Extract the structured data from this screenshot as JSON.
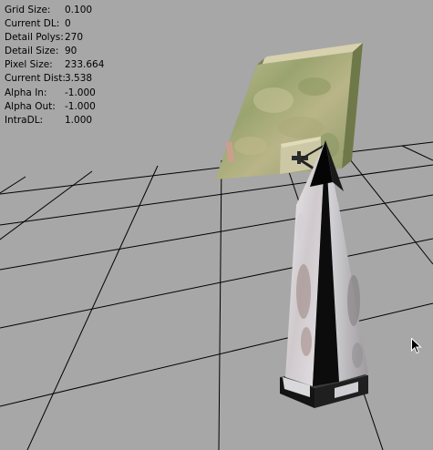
{
  "debug_overlay": {
    "stats": [
      {
        "label": "Grid Size:",
        "value": "0.100"
      },
      {
        "label": "Current DL:",
        "value": "0"
      },
      {
        "label": "Detail Polys:",
        "value": "270"
      },
      {
        "label": "Detail Size:",
        "value": "90"
      },
      {
        "label": "Pixel Size:",
        "value": "233.664"
      },
      {
        "label": "Current Dist:",
        "value": "3.538"
      },
      {
        "label": "Alpha In:",
        "value": "-1.000"
      },
      {
        "label": "Alpha Out:",
        "value": "-1.000"
      },
      {
        "label": "IntraDL:",
        "value": "1.000"
      }
    ]
  },
  "scene": {
    "background_color": "#a7a7a7",
    "grid_color": "#000000",
    "objects": [
      {
        "name": "signboard",
        "colors": [
          "#b7b786",
          "#8e9a68",
          "#c9c49a"
        ]
      },
      {
        "name": "obelisk",
        "colors": [
          "#0c0c0c",
          "#e4e4e8",
          "#b9b4b6"
        ]
      }
    ]
  },
  "cursor": {
    "icon": "arrow-cursor-icon"
  }
}
